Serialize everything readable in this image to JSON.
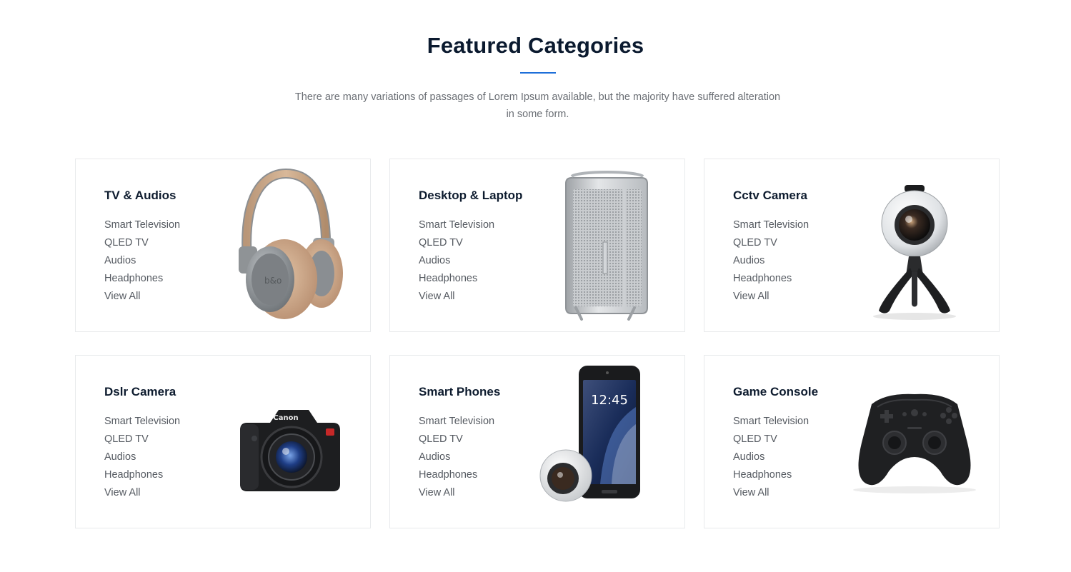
{
  "section": {
    "title": "Featured Categories",
    "subtitle_line1": "There are many variations of passages of Lorem Ipsum available, but the majority have suffered alteration",
    "subtitle_line2": "in some form."
  },
  "colors": {
    "accent": "#1e6fd9",
    "heading": "#0b1a2f",
    "link": "#555a61",
    "border": "#e8eaec"
  },
  "categories": [
    {
      "title": "TV & Audios",
      "image_icon": "headphones-image",
      "links": [
        "Smart Television",
        "QLED TV",
        "Audios",
        "Headphones",
        "View All"
      ]
    },
    {
      "title": "Desktop & Laptop",
      "image_icon": "desktop-tower-image",
      "links": [
        "Smart Television",
        "QLED TV",
        "Audios",
        "Headphones",
        "View All"
      ]
    },
    {
      "title": "Cctv Camera",
      "image_icon": "360-camera-image",
      "links": [
        "Smart Television",
        "QLED TV",
        "Audios",
        "Headphones",
        "View All"
      ]
    },
    {
      "title": "Dslr Camera",
      "image_icon": "dslr-camera-image",
      "links": [
        "Smart Television",
        "QLED TV",
        "Audios",
        "Headphones",
        "View All"
      ]
    },
    {
      "title": "Smart Phones",
      "image_icon": "smartphone-image",
      "phone_clock": "12:45",
      "links": [
        "Smart Television",
        "QLED TV",
        "Audios",
        "Headphones",
        "View All"
      ]
    },
    {
      "title": "Game Console",
      "image_icon": "gamepad-image",
      "links": [
        "Smart Television",
        "QLED TV",
        "Audios",
        "Headphones",
        "View All"
      ]
    }
  ]
}
